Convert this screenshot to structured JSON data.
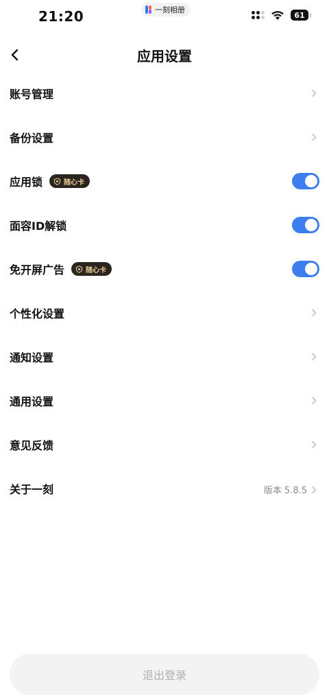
{
  "status_bar": {
    "time": "21:20",
    "app_pill": "一刻相册",
    "battery": "61"
  },
  "nav": {
    "title": "应用设置",
    "back_icon": "chevron-left-icon"
  },
  "badge_text": "随心卡",
  "colors": {
    "toggle_on": "#3c7ef0",
    "badge_bg": "#2b2520",
    "badge_text": "#e8c896"
  },
  "settings": [
    {
      "label": "账号管理",
      "control": "chevron"
    },
    {
      "label": "备份设置",
      "control": "chevron"
    },
    {
      "label": "应用锁",
      "control": "toggle",
      "on": true,
      "badge": "随心卡"
    },
    {
      "label": "面容ID解锁",
      "control": "toggle",
      "on": true
    },
    {
      "label": "免开屏广告",
      "control": "toggle",
      "on": true,
      "badge": "随心卡"
    },
    {
      "label": "个性化设置",
      "control": "chevron"
    },
    {
      "label": "通知设置",
      "control": "chevron"
    },
    {
      "label": "通用设置",
      "control": "chevron"
    },
    {
      "label": "意见反馈",
      "control": "chevron"
    },
    {
      "label": "关于一刻",
      "control": "value",
      "value": "版本 5.8.5"
    }
  ],
  "logout_label": "退出登录"
}
